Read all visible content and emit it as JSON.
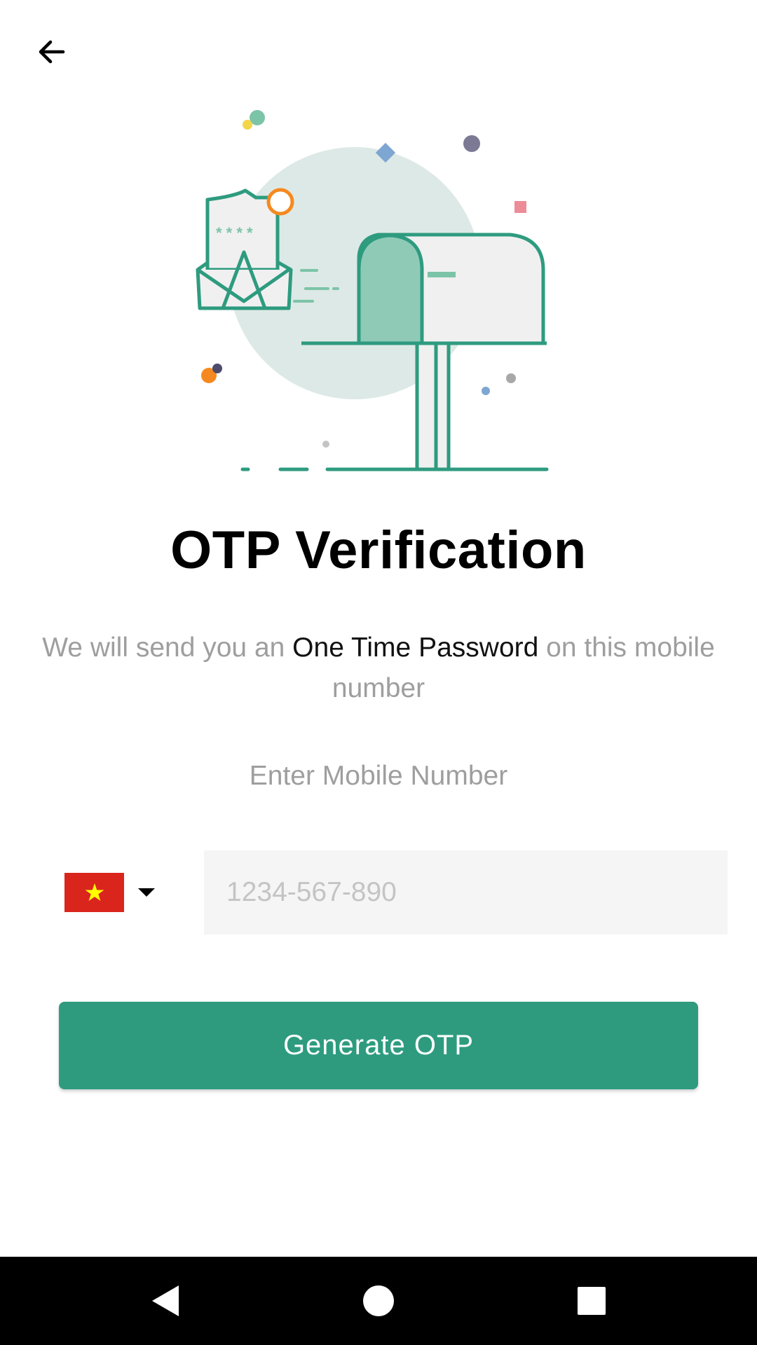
{
  "header": {
    "back_icon": "arrow-left-icon"
  },
  "illustration": {
    "name": "mailbox-envelope-illustration",
    "accent": "#2e9b7f"
  },
  "title": "OTP Verification",
  "subtitle": {
    "prefix": "We will send you an ",
    "emphasis": "One Time Password",
    "suffix": " on this mobile number"
  },
  "phone": {
    "label": "Enter Mobile Number",
    "placeholder": "1234-567-890",
    "value": "",
    "country_flag_icon": "vietnam-flag-icon",
    "dropdown_icon": "caret-down-icon"
  },
  "actions": {
    "generate_label": "Generate OTP"
  },
  "colors": {
    "primary": "#2e9b7f",
    "flag_red": "#da251d",
    "flag_star": "#ffff00"
  },
  "nav": {
    "back_icon": "nav-back-icon",
    "home_icon": "nav-home-icon",
    "recents_icon": "nav-recents-icon"
  }
}
